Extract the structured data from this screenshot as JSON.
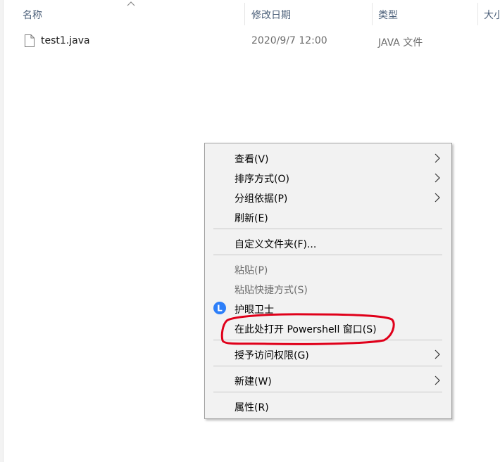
{
  "columns": {
    "name": "名称",
    "date": "修改日期",
    "type": "类型",
    "size": "大小"
  },
  "files": [
    {
      "name": "test1.java",
      "date": "2020/9/7 12:00",
      "type": "JAVA 文件",
      "icon": "file-icon"
    }
  ],
  "context_menu": {
    "items": {
      "view": {
        "label": "查看(V)",
        "submenu": true
      },
      "sort": {
        "label": "排序方式(O)",
        "submenu": true
      },
      "group": {
        "label": "分组依据(P)",
        "submenu": true
      },
      "refresh": {
        "label": "刷新(E)"
      },
      "customize": {
        "label": "自定义文件夹(F)..."
      },
      "paste": {
        "label": "粘贴(P)",
        "disabled": true
      },
      "paste_shortcut": {
        "label": "粘贴快捷方式(S)",
        "disabled": true
      },
      "eye_guard": {
        "label": "护眼卫士",
        "icon": "eye-guard-logo-icon",
        "icon_letter": "L"
      },
      "powershell": {
        "label": "在此处打开 Powershell 窗口(S)"
      },
      "grant_access": {
        "label": "授予访问权限(G)",
        "submenu": true
      },
      "new": {
        "label": "新建(W)",
        "submenu": true
      },
      "properties": {
        "label": "属性(R)"
      }
    }
  },
  "colors": {
    "header_text": "#4c607a",
    "secondary_text": "#6d6d6d",
    "menu_bg": "#f2f2f2",
    "highlight_mark": "#e0001a",
    "logo_blue": "#2d7ff9"
  }
}
